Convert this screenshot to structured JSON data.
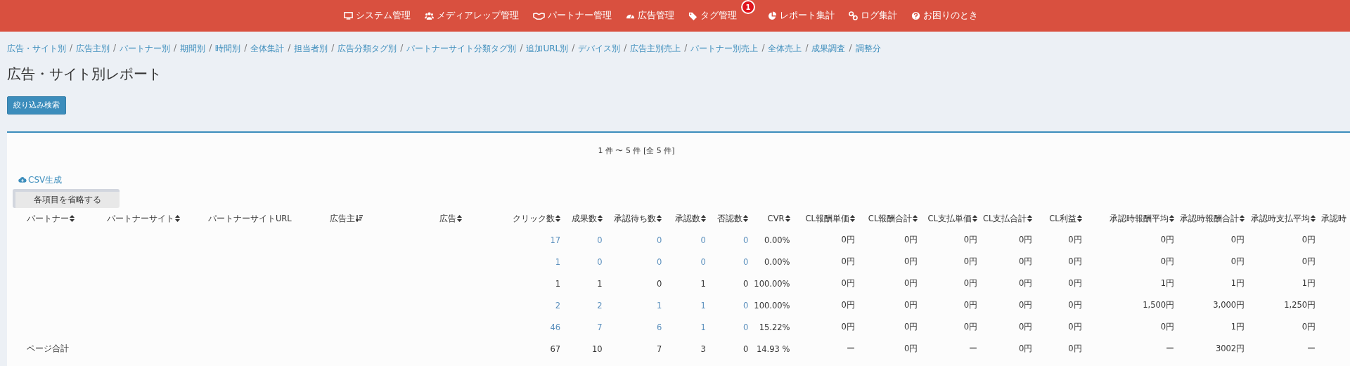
{
  "nav": [
    {
      "label": "システム管理"
    },
    {
      "label": "メディアレップ管理"
    },
    {
      "label": "パートナー管理"
    },
    {
      "label": "広告管理"
    },
    {
      "label": "タグ管理",
      "badge": "1"
    },
    {
      "label": "レポート集計"
    },
    {
      "label": "ログ集計"
    },
    {
      "label": "お困りのとき"
    }
  ],
  "breadcrumbs": {
    "separator": "/",
    "items": [
      "広告・サイト別",
      "広告主別",
      "パートナー別",
      "期間別",
      "時間別",
      "全体集計",
      "担当者別",
      "広告分類タグ別",
      "パートナーサイト分類タグ別",
      "追加URL別",
      "デバイス別",
      "広告主別売上",
      "パートナー別売上",
      "全体売上",
      "成果調査",
      "調整分"
    ]
  },
  "title": "広告・サイト別レポート",
  "filter_button": "絞り込み検索",
  "pagination": "1 件 〜 5 件 [全 5 件]",
  "csv_link": "CSV生成",
  "toggle_button": "各項目を省略する",
  "table": {
    "columns": [
      {
        "label": "パートナー",
        "sortable": true,
        "sorted": false
      },
      {
        "label": "パートナーサイト",
        "sortable": true,
        "sorted": false
      },
      {
        "label": "パートナーサイトURL",
        "sortable": false,
        "sorted": false
      },
      {
        "label": "広告主",
        "sortable": true,
        "sorted": true
      },
      {
        "label": "広告",
        "sortable": true,
        "sorted": false
      },
      {
        "label": "クリック数",
        "sortable": true,
        "sorted": false
      },
      {
        "label": "成果数",
        "sortable": true,
        "sorted": false
      },
      {
        "label": "承認待ち数",
        "sortable": true,
        "sorted": false
      },
      {
        "label": "承認数",
        "sortable": true,
        "sorted": false
      },
      {
        "label": "否認数",
        "sortable": true,
        "sorted": false
      },
      {
        "label": "CVR",
        "sortable": true,
        "sorted": false
      },
      {
        "label": "CL報酬単価",
        "sortable": true,
        "sorted": false
      },
      {
        "label": "CL報酬合計",
        "sortable": true,
        "sorted": false
      },
      {
        "label": "CL支払単価",
        "sortable": true,
        "sorted": false
      },
      {
        "label": "CL支払合計",
        "sortable": true,
        "sorted": false
      },
      {
        "label": "CL利益",
        "sortable": true,
        "sorted": false
      },
      {
        "label": "承認時報酬平均",
        "sortable": true,
        "sorted": false
      },
      {
        "label": "承認時報酬合計",
        "sortable": true,
        "sorted": false
      },
      {
        "label": "承認時支払平均",
        "sortable": true,
        "sorted": false
      },
      {
        "label": "承認時",
        "sortable": false,
        "sorted": false
      }
    ],
    "rows": [
      {
        "cells": [
          {
            "text": ""
          },
          {
            "text": ""
          },
          {
            "text": ""
          },
          {
            "text": ""
          },
          {
            "text": ""
          },
          {
            "text": "17",
            "link": true
          },
          {
            "text": "0",
            "link": true
          },
          {
            "text": "0",
            "link": true
          },
          {
            "text": "0",
            "link": true
          },
          {
            "text": "0",
            "link": true
          },
          {
            "text": "0.00%",
            "link": false
          },
          {
            "text": "0円",
            "link": false
          },
          {
            "text": "0円",
            "link": false
          },
          {
            "text": "0円",
            "link": false
          },
          {
            "text": "0円",
            "link": false
          },
          {
            "text": "0円",
            "link": false
          },
          {
            "text": "0円",
            "link": false
          },
          {
            "text": "0円",
            "link": false
          },
          {
            "text": "0円",
            "link": false
          }
        ]
      },
      {
        "cells": [
          {
            "text": ""
          },
          {
            "text": ""
          },
          {
            "text": ""
          },
          {
            "text": ""
          },
          {
            "text": ""
          },
          {
            "text": "1",
            "link": true
          },
          {
            "text": "0",
            "link": true
          },
          {
            "text": "0",
            "link": true
          },
          {
            "text": "0",
            "link": true
          },
          {
            "text": "0",
            "link": true
          },
          {
            "text": "0.00%",
            "link": false
          },
          {
            "text": "0円",
            "link": false
          },
          {
            "text": "0円",
            "link": false
          },
          {
            "text": "0円",
            "link": false
          },
          {
            "text": "0円",
            "link": false
          },
          {
            "text": "0円",
            "link": false
          },
          {
            "text": "0円",
            "link": false
          },
          {
            "text": "0円",
            "link": false
          },
          {
            "text": "0円",
            "link": false
          }
        ]
      },
      {
        "cells": [
          {
            "text": ""
          },
          {
            "text": ""
          },
          {
            "text": ""
          },
          {
            "text": ""
          },
          {
            "text": ""
          },
          {
            "text": "1",
            "link": false
          },
          {
            "text": "1",
            "link": false
          },
          {
            "text": "0",
            "link": false
          },
          {
            "text": "1",
            "link": false
          },
          {
            "text": "0",
            "link": false
          },
          {
            "text": "100.00%",
            "link": false
          },
          {
            "text": "0円",
            "link": false
          },
          {
            "text": "0円",
            "link": false
          },
          {
            "text": "0円",
            "link": false
          },
          {
            "text": "0円",
            "link": false
          },
          {
            "text": "0円",
            "link": false
          },
          {
            "text": "1円",
            "link": false
          },
          {
            "text": "1円",
            "link": false
          },
          {
            "text": "1円",
            "link": false
          }
        ]
      },
      {
        "cells": [
          {
            "text": ""
          },
          {
            "text": ""
          },
          {
            "text": ""
          },
          {
            "text": ""
          },
          {
            "text": ""
          },
          {
            "text": "2",
            "link": true
          },
          {
            "text": "2",
            "link": true
          },
          {
            "text": "1",
            "link": true
          },
          {
            "text": "1",
            "link": true
          },
          {
            "text": "0",
            "link": true
          },
          {
            "text": "100.00%",
            "link": false
          },
          {
            "text": "0円",
            "link": false
          },
          {
            "text": "0円",
            "link": false
          },
          {
            "text": "0円",
            "link": false
          },
          {
            "text": "0円",
            "link": false
          },
          {
            "text": "0円",
            "link": false
          },
          {
            "text": "1,500円",
            "link": false
          },
          {
            "text": "3,000円",
            "link": false
          },
          {
            "text": "1,250円",
            "link": false
          }
        ]
      },
      {
        "cells": [
          {
            "text": ""
          },
          {
            "text": ""
          },
          {
            "text": ""
          },
          {
            "text": ""
          },
          {
            "text": ""
          },
          {
            "text": "46",
            "link": true
          },
          {
            "text": "7",
            "link": true
          },
          {
            "text": "6",
            "link": true
          },
          {
            "text": "1",
            "link": true
          },
          {
            "text": "0",
            "link": true
          },
          {
            "text": "15.22%",
            "link": false
          },
          {
            "text": "0円",
            "link": false
          },
          {
            "text": "0円",
            "link": false
          },
          {
            "text": "0円",
            "link": false
          },
          {
            "text": "0円",
            "link": false
          },
          {
            "text": "0円",
            "link": false
          },
          {
            "text": "0円",
            "link": false
          },
          {
            "text": "1円",
            "link": false
          },
          {
            "text": "0円",
            "link": false
          }
        ]
      },
      {
        "cells": [
          {
            "text": "ページ合計",
            "link": false
          },
          {
            "text": ""
          },
          {
            "text": ""
          },
          {
            "text": ""
          },
          {
            "text": ""
          },
          {
            "text": "67",
            "link": false
          },
          {
            "text": "10",
            "link": false
          },
          {
            "text": "7",
            "link": false
          },
          {
            "text": "3",
            "link": false
          },
          {
            "text": "0",
            "link": false
          },
          {
            "text": "14.93 %",
            "link": false
          },
          {
            "text": "ー",
            "link": false
          },
          {
            "text": "0円",
            "link": false
          },
          {
            "text": "ー",
            "link": false
          },
          {
            "text": "0円",
            "link": false
          },
          {
            "text": "0円",
            "link": false
          },
          {
            "text": "ー",
            "link": false
          },
          {
            "text": "3002円",
            "link": false
          },
          {
            "text": "ー",
            "link": false
          }
        ]
      }
    ]
  }
}
